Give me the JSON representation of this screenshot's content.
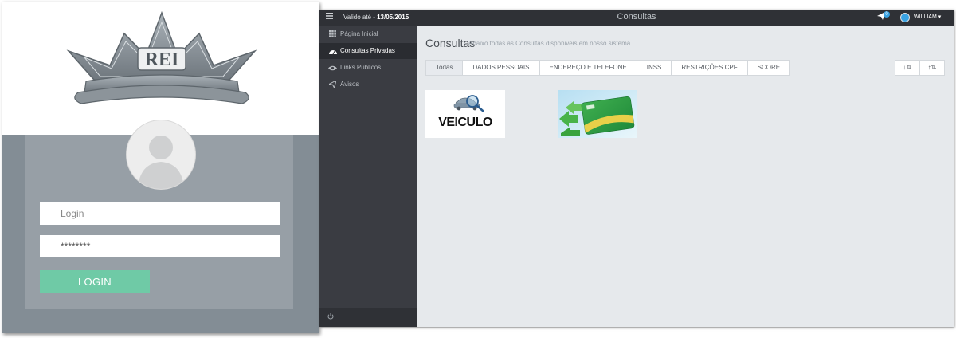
{
  "login": {
    "logo_text": "REI",
    "username_placeholder": "Login",
    "password_value": "********",
    "login_button": "LOGIN"
  },
  "topbar": {
    "valid_label": "Valido até - ",
    "valid_date": "13/05/2015",
    "title": "Consultas",
    "notification_count": "0",
    "user_name": "WILLIAM ▾"
  },
  "sidebar": {
    "items": [
      {
        "label": "Página Inicial",
        "icon": "grid-icon"
      },
      {
        "label": "Consultas Privadas",
        "icon": "dashboard-icon"
      },
      {
        "label": "Links Publicos",
        "icon": "eye-icon"
      },
      {
        "label": "Avisos",
        "icon": "paper-plane-icon"
      }
    ]
  },
  "content": {
    "title": "Consultas",
    "subtitle": "Abaixo todas as Consultas disponiveis em nosso sistema.",
    "tabs": [
      "Todas",
      "DADOS PESSOAIS",
      "ENDEREÇO E TELEFONE",
      "INSS",
      "RESTRIÇÕES CPF",
      "SCORE"
    ],
    "sort_asc": "↓⇅",
    "sort_desc": "↑⇅",
    "cards": [
      {
        "label": "VEICULO"
      }
    ]
  },
  "colors": {
    "accent_green": "#6fcaa6",
    "sidebar_bg": "#3a3c42",
    "topbar_bg": "#2f3136",
    "content_bg": "#e6e9ec",
    "login_gray": "#838d95"
  }
}
